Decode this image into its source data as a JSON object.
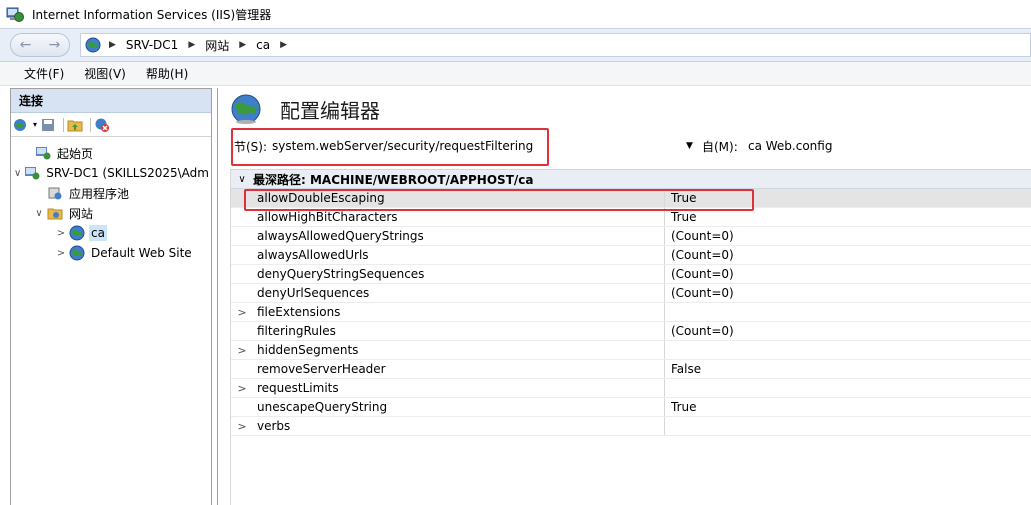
{
  "window": {
    "title": "Internet Information Services (IIS)管理器"
  },
  "address": {
    "crumbs": [
      "SRV-DC1",
      "网站",
      "ca"
    ]
  },
  "menu": [
    "文件(F)",
    "视图(V)",
    "帮助(H)"
  ],
  "connections": {
    "header": "连接",
    "tree": [
      {
        "label": "起始页",
        "level": 1,
        "toggle": ""
      },
      {
        "label": "SRV-DC1 (SKILLS2025\\Adm",
        "level": 0,
        "toggle": "∨"
      },
      {
        "label": "应用程序池",
        "level": 1,
        "toggle": ""
      },
      {
        "label": "网站",
        "level": 1,
        "toggle": "∨"
      },
      {
        "label": "ca",
        "level": 2,
        "toggle": ">",
        "selected": true
      },
      {
        "label": "Default Web Site",
        "level": 2,
        "toggle": ">"
      }
    ]
  },
  "editor": {
    "title": "配置编辑器",
    "section_label": "节(S):",
    "section_value": "system.webServer/security/requestFiltering",
    "from_label": "自(M):",
    "from_value": "ca Web.config",
    "path_label": "最深路径: MACHINE/WEBROOT/APPHOST/ca",
    "rows": [
      {
        "name": "allowDoubleEscaping",
        "value": "True",
        "expand": false,
        "highlight": true
      },
      {
        "name": "allowHighBitCharacters",
        "value": "True",
        "expand": false
      },
      {
        "name": "alwaysAllowedQueryStrings",
        "value": "(Count=0)",
        "expand": false
      },
      {
        "name": "alwaysAllowedUrls",
        "value": "(Count=0)",
        "expand": false
      },
      {
        "name": "denyQueryStringSequences",
        "value": "(Count=0)",
        "expand": false
      },
      {
        "name": "denyUrlSequences",
        "value": "(Count=0)",
        "expand": false
      },
      {
        "name": "fileExtensions",
        "value": "",
        "expand": true
      },
      {
        "name": "filteringRules",
        "value": "(Count=0)",
        "expand": false
      },
      {
        "name": "hiddenSegments",
        "value": "",
        "expand": true
      },
      {
        "name": "removeServerHeader",
        "value": "False",
        "expand": false
      },
      {
        "name": "requestLimits",
        "value": "",
        "expand": true
      },
      {
        "name": "unescapeQueryString",
        "value": "True",
        "expand": false
      },
      {
        "name": "verbs",
        "value": "",
        "expand": true
      }
    ]
  },
  "colors": {
    "highlight_box": "#e0303a",
    "selection": "#cce4f7"
  }
}
